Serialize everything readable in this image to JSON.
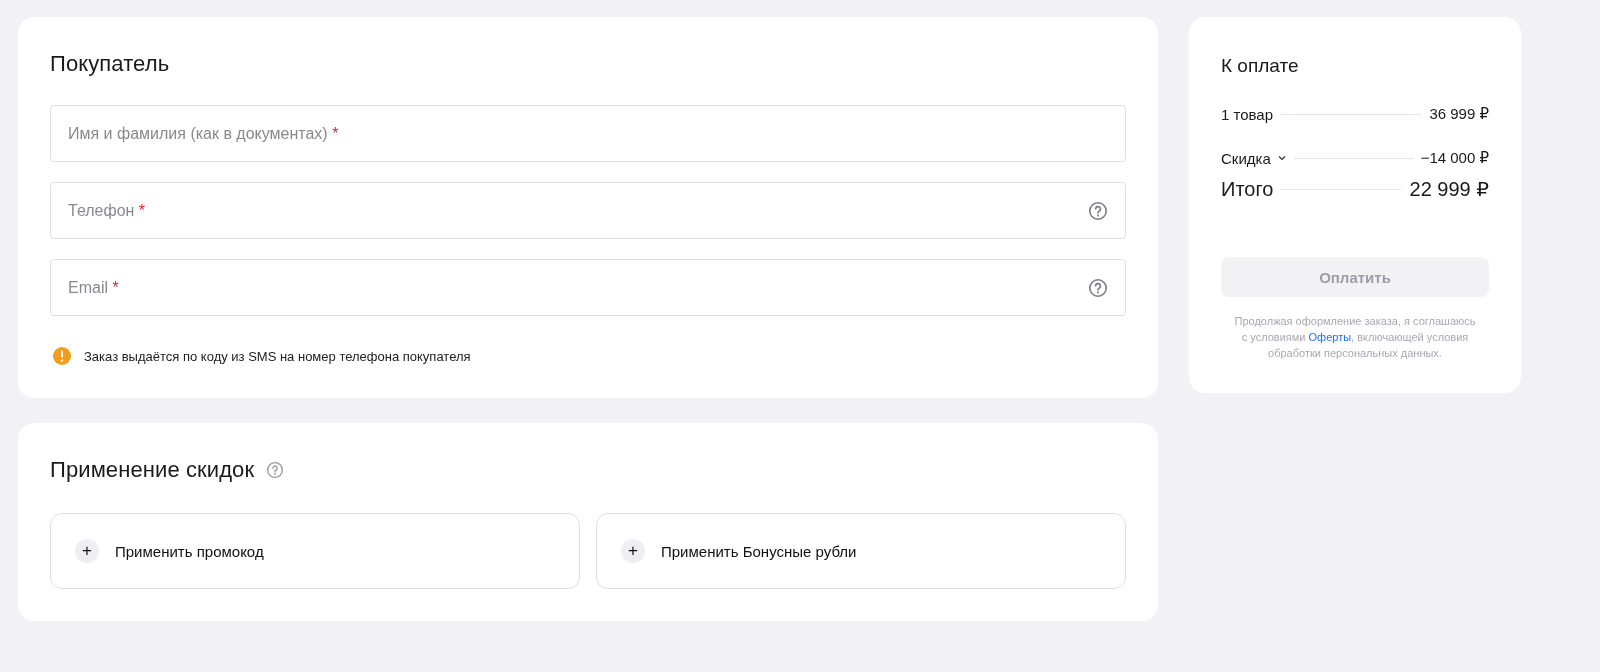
{
  "buyer": {
    "title": "Покупатель",
    "fields": [
      {
        "placeholder": "Имя и фамилия (как в документах)",
        "required_mark": "*",
        "help": false
      },
      {
        "placeholder": "Телефон",
        "required_mark": "*",
        "help": true
      },
      {
        "placeholder": "Email",
        "required_mark": "*",
        "help": true
      }
    ],
    "notice": "Заказ выдаётся по коду из SMS на номер телефона покупателя"
  },
  "discounts": {
    "title": "Применение скидок",
    "help": true,
    "actions": [
      {
        "icon": "+",
        "label": "Применить промокод"
      },
      {
        "icon": "+",
        "label": "Применить Бонусные рубли"
      }
    ]
  },
  "summary": {
    "title": "К оплате",
    "rows": [
      {
        "kind": "item",
        "label": "1 товар",
        "value": "36 999 ₽"
      },
      {
        "kind": "discount",
        "label": "Скидка",
        "value": "−14 000 ₽"
      },
      {
        "kind": "total",
        "label": "Итого",
        "value": "22 999 ₽"
      }
    ],
    "pay_button": {
      "label": "Оплатить",
      "disabled": true
    },
    "legal": {
      "before": "Продолжая оформление заказа, я соглашаюсь с условиями ",
      "link": "Оферты",
      "after": ", включающей условия обработки персональных данных."
    }
  }
}
